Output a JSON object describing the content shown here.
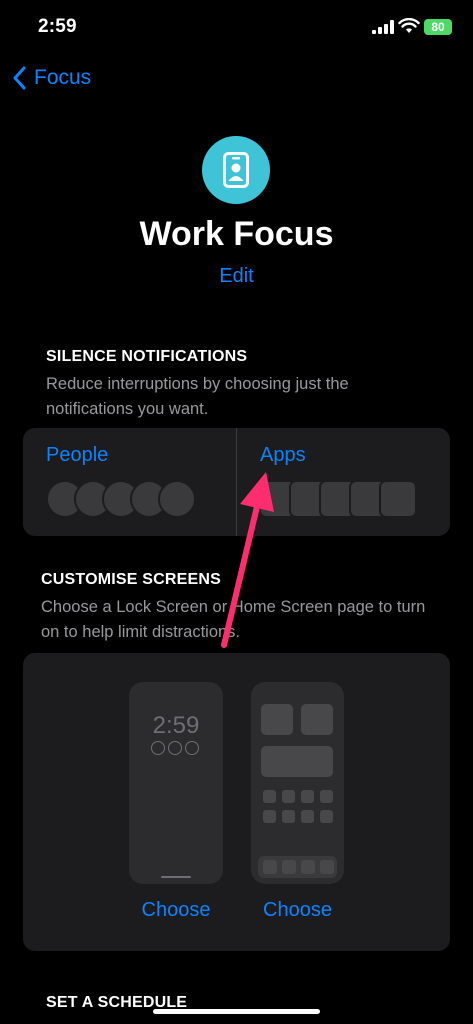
{
  "status_bar": {
    "time": "2:59",
    "battery": "80"
  },
  "nav": {
    "back_label": "Focus"
  },
  "header": {
    "title": "Work Focus",
    "edit_label": "Edit"
  },
  "silence": {
    "heading": "SILENCE NOTIFICATIONS",
    "description": "Reduce interruptions by choosing just the notifications you want.",
    "people_label": "People",
    "apps_label": "Apps"
  },
  "customise": {
    "heading": "CUSTOMISE SCREENS",
    "description": "Choose a Lock Screen or Home Screen page to turn on to help limit distractions.",
    "lock_time": "2:59",
    "choose_lock": "Choose",
    "choose_home": "Choose"
  },
  "schedule": {
    "heading": "SET A SCHEDULE"
  },
  "colors": {
    "accent": "#0a84ff",
    "focus_icon": "#3fc3d6",
    "arrow": "#ff2d6f"
  }
}
